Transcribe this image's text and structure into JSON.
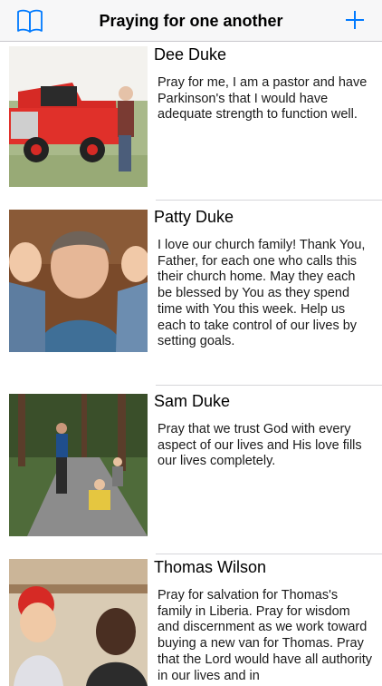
{
  "navbar": {
    "title": "Praying for one another",
    "left_icon": "book-icon",
    "right_icon": "plus-icon",
    "accent": "#007aff"
  },
  "prayers": [
    {
      "name": "Dee Duke",
      "message": "Pray for me, I am a pastor and have Parkinson's that I would have adequate strength to function well."
    },
    {
      "name": "Patty Duke",
      "message": "I love our church family! Thank You, Father, for each one who calls this their church home. May they each be blessed by You as they spend time with You this week. Help us each to take control of our lives by setting goals."
    },
    {
      "name": "Sam Duke",
      "message": "Pray that we trust God with every aspect of our lives and His love fills our lives completely."
    },
    {
      "name": "Thomas Wilson",
      "message": "Pray for salvation for Thomas's family in Liberia. Pray for wisdom and discernment as we work toward buying a new van for Thomas. Pray that the Lord would have all authority in our lives and in"
    }
  ]
}
